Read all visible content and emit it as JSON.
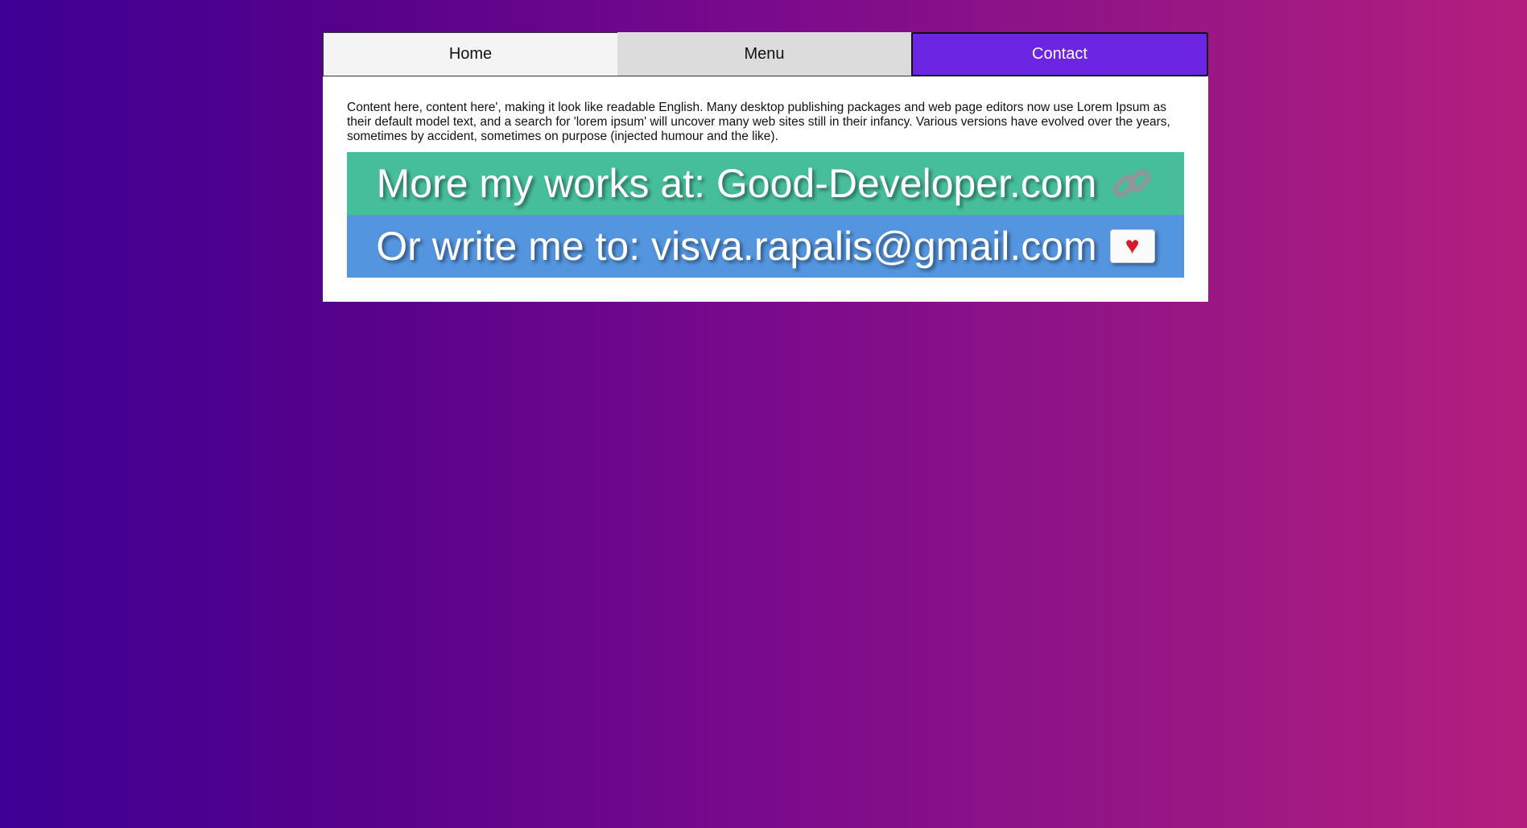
{
  "nav": {
    "tabs": [
      {
        "label": "Home"
      },
      {
        "label": "Menu"
      },
      {
        "label": "Contact"
      }
    ],
    "active_tab": "Contact",
    "active_color": "#6c25e3"
  },
  "content": {
    "paragraph": "Content here, content here', making it look like readable English. Many desktop publishing packages and web page editors now use Lorem Ipsum as their default model text, and a search for 'lorem ipsum' will uncover many web sites still in their infancy. Various versions have evolved over the years, sometimes by accident, sometimes on purpose (injected humour and the like).",
    "works_banner": {
      "text": "More my works at: Good-Developer.com",
      "icon": "link-icon",
      "color": "#47be9b"
    },
    "mail_banner": {
      "text": "Or write me to: visva.rapalis@gmail.com",
      "icon": "love-letter-icon",
      "color": "#5495df"
    }
  }
}
